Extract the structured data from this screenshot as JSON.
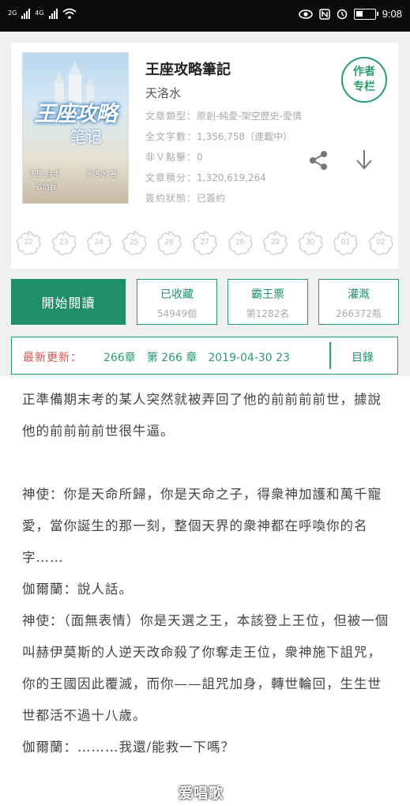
{
  "status_bar": {
    "carrier_1": "2G",
    "carrier_2": "4G",
    "time": "9:08"
  },
  "book": {
    "title": "王座攻略筆記",
    "author": "天洛水",
    "cover": {
      "title_main": "王座攻略",
      "title_sub": "笔记",
      "credit_left": "天座 目本",
      "credit_right": "天洛水 著",
      "credit_bottom": "猛信我"
    },
    "meta": [
      {
        "label": "文章類型：",
        "value": "原創-純愛-架空歷史-愛情"
      },
      {
        "label": "全文字數：",
        "value": "1,356,758（連載中）"
      },
      {
        "label": "非Ｖ點擊：",
        "value": "0"
      },
      {
        "label": "文章積分：",
        "value": "1,320,619,264"
      },
      {
        "label": "簽約狀態：",
        "value": "已簽約"
      }
    ],
    "author_column_line1": "作者",
    "author_column_line2": "专栏",
    "stamps": [
      "22",
      "23",
      "24",
      "25",
      "26",
      "27",
      "28",
      "29",
      "30",
      "01",
      "02"
    ]
  },
  "actions": {
    "read": "開始閱讀",
    "collect": {
      "label": "已收藏",
      "count": "54949個"
    },
    "king_ticket": {
      "label": "霸王票",
      "count": "第1282名"
    },
    "irrigate": {
      "label": "灌溉",
      "count": "266372瓶"
    }
  },
  "update": {
    "label": "最新更新：",
    "text": "266章　第 266 章　2019-04-30 23",
    "toc": "目錄"
  },
  "content": [
    "正準備期末考的某人突然就被弄回了他的前前前前世，據說他的前前前前世很牛逼。",
    "",
    "神使：你是天命所歸，你是天命之子，得衆神加護和萬千寵愛，當你誕生的那一刻，整個天界的衆神都在呼喚你的名字……",
    "伽爾蘭：說人話。",
    "神使：（面無表情）你是天選之王，本該登上王位，但被一個叫赫伊莫斯的人逆天改命殺了你奪走王位，衆神施下詛咒，你的王國因此覆滅，而你——詛咒加身，轉世輪回，生生世世都活不過十八歲。",
    "伽爾蘭：………我還/能救一下嗎？"
  ],
  "watermark": "爱唱歌"
}
